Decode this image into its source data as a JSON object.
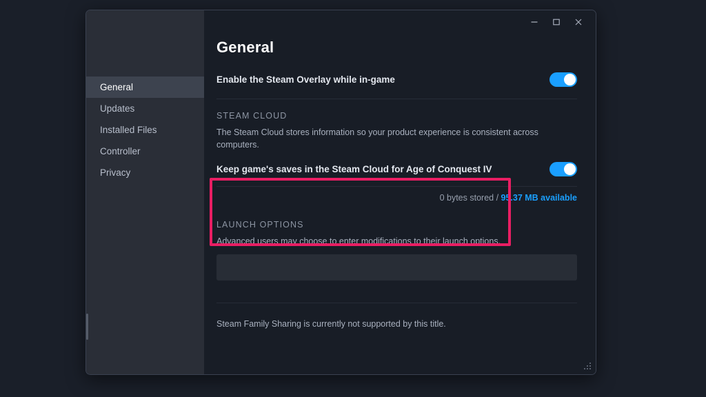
{
  "window": {
    "controls": {
      "minimize": "minimize-icon",
      "maximize": "maximize-icon",
      "close": "close-icon"
    },
    "resize_grip": "resize-grip-icon"
  },
  "sidebar": {
    "items": [
      {
        "label": "General",
        "active": true
      },
      {
        "label": "Updates",
        "active": false
      },
      {
        "label": "Installed Files",
        "active": false
      },
      {
        "label": "Controller",
        "active": false
      },
      {
        "label": "Privacy",
        "active": false
      }
    ]
  },
  "main": {
    "title": "General",
    "overlay": {
      "label": "Enable the Steam Overlay while in-game",
      "enabled": true
    },
    "steam_cloud": {
      "heading": "STEAM CLOUD",
      "description": "The Steam Cloud stores information so your product experience is consistent across computers.",
      "toggle_label": "Keep game's saves in the Steam Cloud for Age of Conquest IV",
      "enabled": true,
      "stored_text": "0 bytes stored / ",
      "available_text": "95.37 MB available"
    },
    "launch_options": {
      "heading": "LAUNCH OPTIONS",
      "description": "Advanced users may choose to enter modifications to their launch options.",
      "value": "",
      "placeholder": ""
    },
    "family_sharing_note": "Steam Family Sharing is currently not supported by this title."
  },
  "annotation": {
    "highlight_color": "#e91e63",
    "target": "launch-options-section"
  },
  "colors": {
    "accent_blue": "#1a9fff",
    "highlight_pink": "#e91e63",
    "window_bg": "#181d26",
    "sidebar_bg": "#2a2e37",
    "sidebar_active": "#3d434f"
  }
}
